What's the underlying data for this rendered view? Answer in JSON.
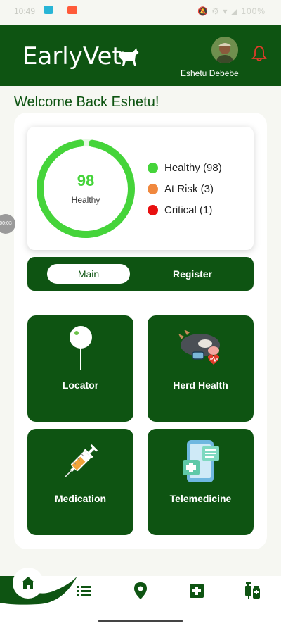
{
  "status_bar": {
    "time": "10:49",
    "right_text": "🔕 ⚙ ▾ ◢ 100%"
  },
  "header": {
    "logo_text": "EarlyVet",
    "user_name": "Eshetu Debebe"
  },
  "welcome_text": "Welcome Back Eshetu!",
  "health_summary": {
    "ring_value": "98",
    "ring_label": "Healthy",
    "ring_fraction": 0.96,
    "legend": [
      {
        "label": "Healthy (98)",
        "color": "#45d43a"
      },
      {
        "label": "At Risk (3)",
        "color": "#f0883e"
      },
      {
        "label": "Critical (1)",
        "color": "#e81010"
      }
    ]
  },
  "side_timer": "00:03",
  "tabs": [
    {
      "label": "Main",
      "active": true
    },
    {
      "label": "Register",
      "active": false
    }
  ],
  "tiles": [
    {
      "label": "Locator",
      "icon": "map-pin-icon"
    },
    {
      "label": "Herd Health",
      "icon": "cow-health-icon"
    },
    {
      "label": "Medication",
      "icon": "syringe-icon"
    },
    {
      "label": "Telemedicine",
      "icon": "phone-medical-icon"
    }
  ],
  "bottom_nav": [
    {
      "name": "home",
      "icon": "home-icon",
      "active": true
    },
    {
      "name": "list",
      "icon": "list-icon",
      "active": false
    },
    {
      "name": "location",
      "icon": "location-pin-icon",
      "active": false
    },
    {
      "name": "medical",
      "icon": "medical-cross-icon",
      "active": false
    },
    {
      "name": "vaccines",
      "icon": "vaccine-icon",
      "active": false
    }
  ],
  "colors": {
    "brand_green": "#0e5412",
    "healthy_green": "#45d43a",
    "background": "#f6f7f2",
    "bell_red": "#e23b2a"
  }
}
